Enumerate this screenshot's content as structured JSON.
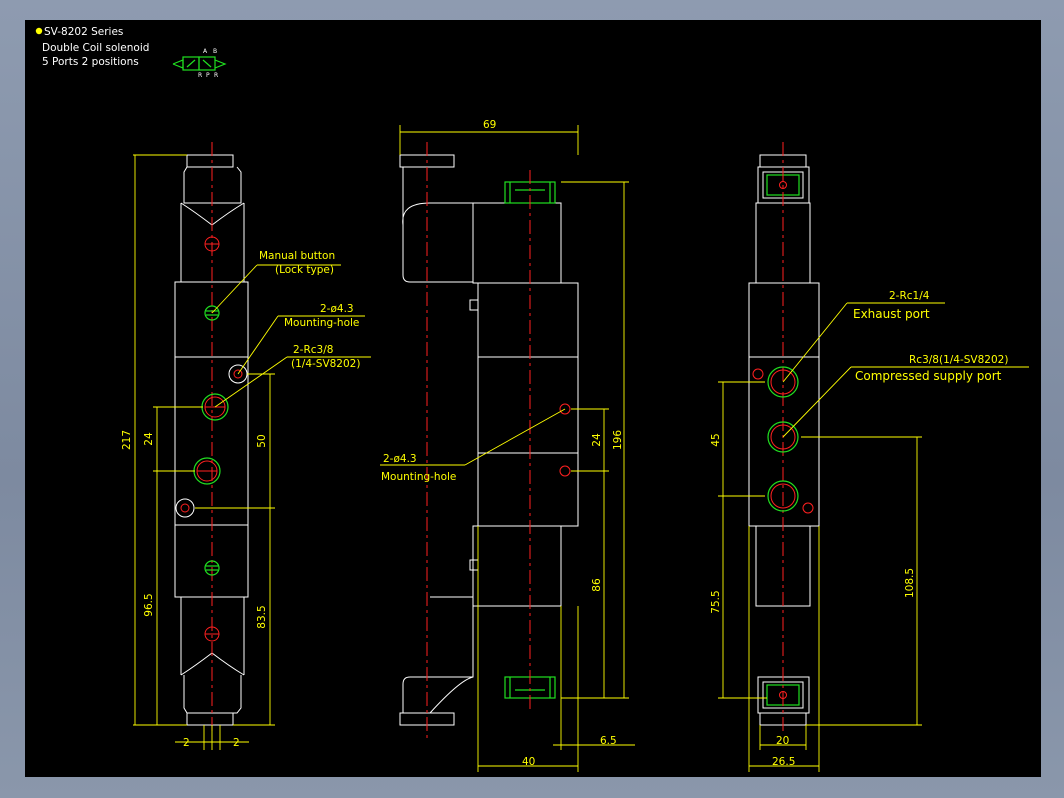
{
  "header": {
    "series": "SV-8202 Series",
    "description": "Double Coil solenoid",
    "ports": "5 Ports 2 positions",
    "symbol_labels": [
      "A",
      "B",
      "R",
      "P",
      "R"
    ]
  },
  "colors": {
    "background": "#000000",
    "outline": "#ffffff",
    "dimension": "#ffff00",
    "centerline": "#ff2020",
    "port_fitting": "#20e020",
    "frame": "#8a97ab"
  },
  "left_view": {
    "callouts": {
      "manual_1": "Manual button",
      "manual_2": "(Lock type)",
      "mount_1": "2-ø4.3",
      "mount_2": "Mounting-hole",
      "port_1": "2-Rc3/8",
      "port_2": "(1/4-SV8202)"
    },
    "dims": {
      "total": "217",
      "pitch_24": "24",
      "pitch_50": "50",
      "lower_96_5": "96.5",
      "lower_83_5": "83.5",
      "left_2": "2",
      "right_2": "2"
    }
  },
  "middle_view": {
    "callouts": {
      "mount_1": "2-ø4.3",
      "mount_2": "Mounting-hole"
    },
    "dims": {
      "width_69": "69",
      "height_196": "196",
      "pitch_24": "24",
      "lower_86": "86",
      "body_40": "40",
      "offset_6_5": "6.5"
    }
  },
  "right_view": {
    "callouts": {
      "exhaust_1": "2-Rc1/4",
      "exhaust_2": "Exhaust port",
      "supply_1": "Rc3/8(1/4-SV8202)",
      "supply_2": "Compressed supply port"
    },
    "dims": {
      "pitch_45": "45",
      "lower_75_5": "75.5",
      "height_108_5": "108.5",
      "width_20": "20",
      "width_26_5": "26.5"
    }
  }
}
